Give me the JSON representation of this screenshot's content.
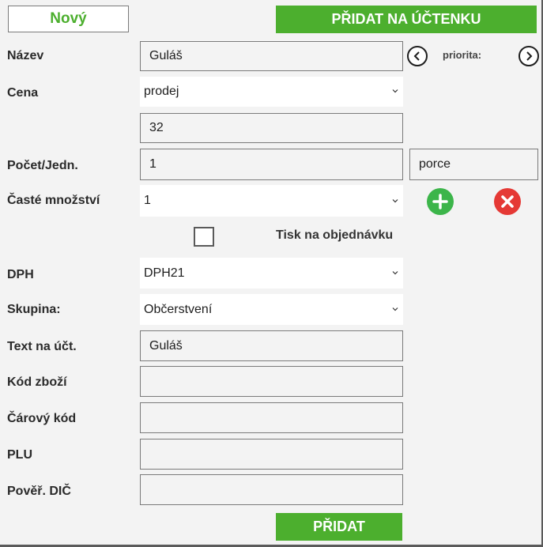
{
  "toolbar": {
    "new_label": "Nový",
    "add_to_receipt_label": "PŘIDAT NA ÚČTENKU"
  },
  "form": {
    "name": {
      "label": "Název",
      "value": "Guláš"
    },
    "priority_label": "priorita:",
    "price": {
      "label": "Cena",
      "select_value": "prodej",
      "value": "32"
    },
    "quantity": {
      "label": "Počet/Jedn.",
      "value": "1",
      "unit": "porce"
    },
    "frequent_qty": {
      "label": "Časté množství",
      "select_value": "1"
    },
    "print_order": {
      "label": "Tisk na objednávku",
      "checked": false
    },
    "vat": {
      "label": "DPH",
      "select_value": "DPH21"
    },
    "group": {
      "label": "Skupina:",
      "select_value": "Občerstvení"
    },
    "receipt_text": {
      "label": "Text na účt.",
      "value": "Guláš"
    },
    "product_code": {
      "label": "Kód zboží",
      "value": ""
    },
    "barcode": {
      "label": "Čárový kód",
      "value": ""
    },
    "plu": {
      "label": "PLU",
      "value": ""
    },
    "tax_id": {
      "label": "Pověř. DIČ",
      "value": ""
    }
  },
  "footer": {
    "add_label": "PŘIDAT"
  },
  "colors": {
    "accent_green": "#4caf2e",
    "add_icon": "#3cb54a",
    "remove_icon": "#e53935"
  }
}
